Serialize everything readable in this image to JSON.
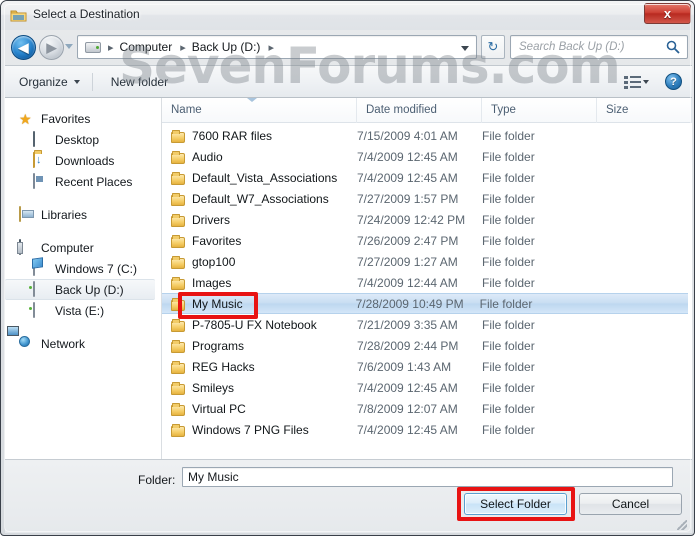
{
  "window": {
    "title": "Select a Destination",
    "title_icon": "folder-icon",
    "close_label": "x"
  },
  "watermark": {
    "text": "SevenForums.com"
  },
  "navbar": {
    "back_arrow": "◀",
    "forward_arrow": "▶",
    "breadcrumbs": [
      "Computer",
      "Back Up (D:)"
    ],
    "separator": "▸",
    "refresh_icon": "↻",
    "search_placeholder": "Search Back Up (D:)",
    "search_icon": "⚲"
  },
  "toolbar": {
    "organize_label": "Organize",
    "new_folder_label": "New folder",
    "help_label": "?"
  },
  "navpane": {
    "groups": [
      {
        "header": {
          "label": "Favorites",
          "icon": "star-icon"
        },
        "items": [
          {
            "label": "Desktop",
            "icon": "monitor-icon"
          },
          {
            "label": "Downloads",
            "icon": "downloads-folder-icon"
          },
          {
            "label": "Recent Places",
            "icon": "recent-places-icon"
          }
        ]
      },
      {
        "header": {
          "label": "Libraries",
          "icon": "library-icon"
        },
        "items": []
      },
      {
        "header": {
          "label": "Computer",
          "icon": "computer-icon"
        },
        "items": [
          {
            "label": "Windows 7 (C:)",
            "icon": "windows-drive-icon",
            "selected": false
          },
          {
            "label": "Back Up (D:)",
            "icon": "hdd-icon",
            "selected": true
          },
          {
            "label": "Vista (E:)",
            "icon": "hdd-icon",
            "selected": false
          }
        ]
      },
      {
        "header": {
          "label": "Network",
          "icon": "network-icon"
        },
        "items": []
      }
    ]
  },
  "filelist": {
    "columns": [
      "Name",
      "Date modified",
      "Type",
      "Size"
    ],
    "rows": [
      {
        "name": "7600 RAR files",
        "date": "7/15/2009 4:01 AM",
        "type": "File folder",
        "size": "",
        "selected": false
      },
      {
        "name": "Audio",
        "date": "7/4/2009 12:45 AM",
        "type": "File folder",
        "size": "",
        "selected": false
      },
      {
        "name": "Default_Vista_Associations",
        "date": "7/4/2009 12:45 AM",
        "type": "File folder",
        "size": "",
        "selected": false
      },
      {
        "name": "Default_W7_Associations",
        "date": "7/27/2009 1:57 PM",
        "type": "File folder",
        "size": "",
        "selected": false
      },
      {
        "name": "Drivers",
        "date": "7/24/2009 12:42 PM",
        "type": "File folder",
        "size": "",
        "selected": false
      },
      {
        "name": "Favorites",
        "date": "7/26/2009 2:47 PM",
        "type": "File folder",
        "size": "",
        "selected": false
      },
      {
        "name": "gtop100",
        "date": "7/27/2009 1:27 AM",
        "type": "File folder",
        "size": "",
        "selected": false
      },
      {
        "name": "Images",
        "date": "7/4/2009 12:44 AM",
        "type": "File folder",
        "size": "",
        "selected": false
      },
      {
        "name": "My Music",
        "date": "7/28/2009 10:49 PM",
        "type": "File folder",
        "size": "",
        "selected": true
      },
      {
        "name": "P-7805-U FX Notebook",
        "date": "7/21/2009 3:35 AM",
        "type": "File folder",
        "size": "",
        "selected": false
      },
      {
        "name": "Programs",
        "date": "7/28/2009 2:44 PM",
        "type": "File folder",
        "size": "",
        "selected": false
      },
      {
        "name": "REG Hacks",
        "date": "7/6/2009 1:43 AM",
        "type": "File folder",
        "size": "",
        "selected": false
      },
      {
        "name": "Smileys",
        "date": "7/4/2009 12:45 AM",
        "type": "File folder",
        "size": "",
        "selected": false
      },
      {
        "name": "Virtual PC",
        "date": "7/8/2009 12:07 AM",
        "type": "File folder",
        "size": "",
        "selected": false
      },
      {
        "name": "Windows 7 PNG Files",
        "date": "7/4/2009 12:45 AM",
        "type": "File folder",
        "size": "",
        "selected": false
      }
    ]
  },
  "footer": {
    "folder_label": "Folder:",
    "folder_value": "My Music",
    "select_button": "Select Folder",
    "cancel_button": "Cancel"
  },
  "colors": {
    "annotation": "#e81313",
    "selection": "#c7ddf2",
    "close_button": "#cd4135"
  }
}
